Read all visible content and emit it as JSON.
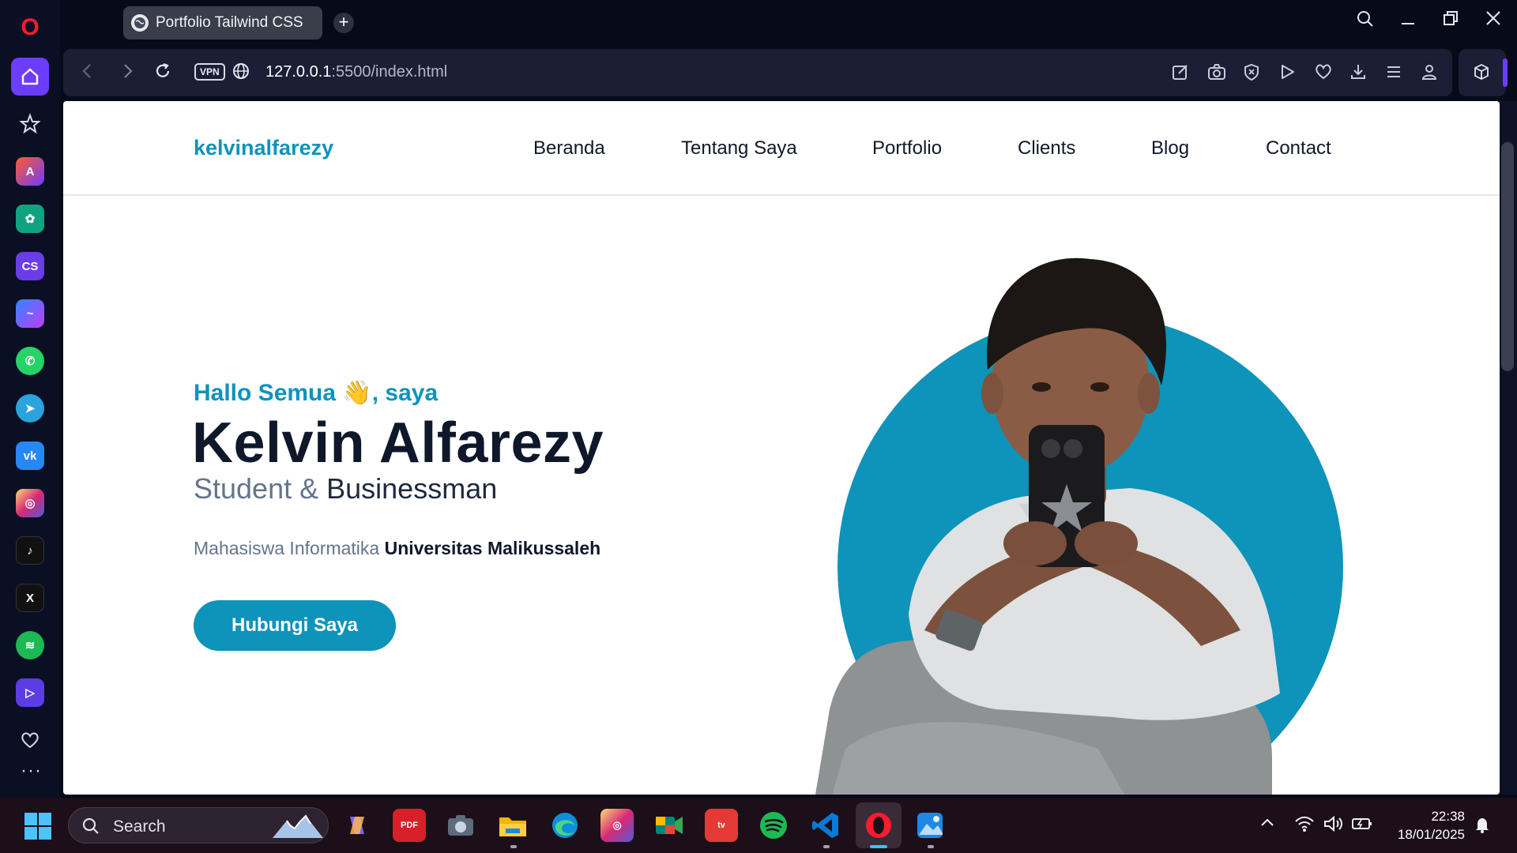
{
  "browser": {
    "tab_title": "Portfolio Tailwind CSS",
    "new_tab_label": "+",
    "vpn_label": "VPN",
    "url_host": "127.0.0.1",
    "url_rest": ":5500/index.html"
  },
  "sidebar": {
    "logo": "O",
    "items": [
      {
        "name": "home",
        "label": "⌂",
        "color": "#6d3cff"
      },
      {
        "name": "bookmarks",
        "label": "☆",
        "color": "transparent"
      },
      {
        "name": "aria",
        "label": "A",
        "color": "#e8492d"
      },
      {
        "name": "chatgpt",
        "label": "✿",
        "color": "#10a37f"
      },
      {
        "name": "chatsonic",
        "label": "CS",
        "color": "#6a3de8"
      },
      {
        "name": "messenger",
        "label": "m",
        "color": "#7b5cff"
      },
      {
        "name": "whatsapp",
        "label": "✆",
        "color": "#25d366"
      },
      {
        "name": "telegram",
        "label": "➤",
        "color": "#2aa3df"
      },
      {
        "name": "vk",
        "label": "vk",
        "color": "#2787f5"
      },
      {
        "name": "instagram",
        "label": "◎",
        "color": "#e1306c"
      },
      {
        "name": "tiktok",
        "label": "♪",
        "color": "#111111"
      },
      {
        "name": "x",
        "label": "X",
        "color": "#111111"
      },
      {
        "name": "spotify",
        "label": "≋",
        "color": "#1db954"
      },
      {
        "name": "player",
        "label": "▷",
        "color": "#5b3de6"
      },
      {
        "name": "heart",
        "label": "♡",
        "color": "transparent"
      }
    ],
    "more_label": "···"
  },
  "site": {
    "brand": "kelvinalfarezy",
    "nav": [
      "Beranda",
      "Tentang Saya",
      "Portfolio",
      "Clients",
      "Blog",
      "Contact"
    ],
    "greeting": "Hallo Semua 👋, saya",
    "name": "Kelvin Alfarezy",
    "role_part1": "Student & ",
    "role_part2": "Businessman",
    "desc_part1": "Mahasiswa Informatika ",
    "desc_part2": "Universitas Malikussaleh",
    "cta": "Hubungi Saya",
    "accent": "#0e93ba"
  },
  "taskbar": {
    "search_label": "Search",
    "time": "22:38",
    "date": "18/01/2025",
    "apps": [
      {
        "name": "copilot",
        "label": "◆",
        "color": "#7b61ff"
      },
      {
        "name": "pdf-x",
        "label": "PDF",
        "color": "#d6202a"
      },
      {
        "name": "camera",
        "label": "◉",
        "color": "#5d6b7a"
      },
      {
        "name": "file-explorer",
        "label": "▬",
        "color": "#f4b400"
      },
      {
        "name": "edge",
        "label": "e",
        "color": "#0f8fd8"
      },
      {
        "name": "instagram",
        "label": "◎",
        "color": "#d6249f"
      },
      {
        "name": "google-meet",
        "label": "▶",
        "color": "#00897b"
      },
      {
        "name": "ome-tv",
        "label": "tv",
        "color": "#e53935"
      },
      {
        "name": "spotify",
        "label": "≋",
        "color": "#1db954"
      },
      {
        "name": "vscode",
        "label": "❯",
        "color": "#0078d4"
      },
      {
        "name": "opera",
        "label": "O",
        "color": "#ff1b2d"
      },
      {
        "name": "photos",
        "label": "▲",
        "color": "#1e88e5"
      }
    ]
  }
}
